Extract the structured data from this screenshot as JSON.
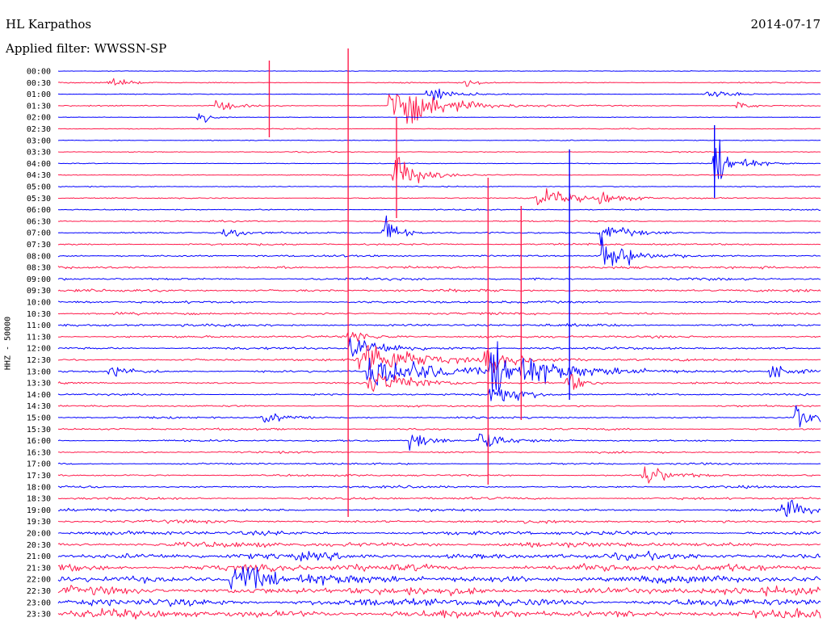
{
  "header": {
    "station": "HL Karpathos",
    "date": "2014-07-17",
    "filter": "Applied filter: WWSSN-SP",
    "channel": "HHZ - 50000"
  },
  "colors": {
    "trace_a": "#0000ff",
    "trace_b": "#ff1a4b"
  },
  "chart_data": {
    "type": "line",
    "title": "HL Karpathos",
    "date": "2014-07-17",
    "filter": "WWSSN-SP",
    "ylabel": "HHZ - 50000",
    "row_labels": [
      "00:00",
      "00:30",
      "01:00",
      "01:30",
      "02:00",
      "02:30",
      "03:00",
      "03:30",
      "04:00",
      "04:30",
      "05:00",
      "05:30",
      "06:00",
      "06:30",
      "07:00",
      "07:30",
      "08:00",
      "08:30",
      "09:00",
      "09:30",
      "10:00",
      "10:30",
      "11:00",
      "11:30",
      "12:00",
      "12:30",
      "13:00",
      "13:30",
      "14:00",
      "14:30",
      "15:00",
      "15:30",
      "16:00",
      "16:30",
      "17:00",
      "17:30",
      "18:00",
      "18:30",
      "19:00",
      "19:30",
      "20:00",
      "20:30",
      "21:00",
      "21:30",
      "22:00",
      "22:30",
      "23:00",
      "23:30"
    ],
    "series": [
      {
        "color": "#0000ff",
        "rows": "even"
      },
      {
        "color": "#ff1a4b",
        "rows": "odd"
      }
    ],
    "noise_level": [
      0.3,
      0.5,
      0.4,
      0.6,
      0.3,
      0.5,
      0.4,
      0.5,
      0.4,
      0.5,
      0.5,
      0.6,
      0.6,
      0.7,
      0.9,
      1.0,
      1.1,
      1.2,
      1.2,
      1.3,
      1.2,
      1.2,
      1.3,
      1.2,
      1.2,
      1.1,
      1.0,
      0.9,
      0.9,
      0.9,
      0.9,
      1.0,
      0.9,
      0.9,
      0.9,
      1.0,
      1.1,
      1.2,
      1.3,
      1.5,
      2.0,
      2.6,
      3.2,
      3.6,
      3.8,
      3.8,
      3.9,
      4.0
    ],
    "events": [
      {
        "row": 1,
        "minute": 2.0,
        "amp": 6,
        "dur": 0.6
      },
      {
        "row": 1,
        "minute": 16.0,
        "amp": 4,
        "dur": 0.5
      },
      {
        "row": 2,
        "minute": 14.5,
        "amp": 10,
        "dur": 0.8
      },
      {
        "row": 2,
        "minute": 25.5,
        "amp": 5,
        "dur": 0.8
      },
      {
        "row": 3,
        "minute": 6.2,
        "amp": 8,
        "dur": 0.5
      },
      {
        "row": 3,
        "minute": 13.0,
        "amp": 30,
        "dur": 1.5
      },
      {
        "row": 3,
        "minute": 26.6,
        "amp": 6,
        "dur": 0.4
      },
      {
        "row": 4,
        "minute": 5.5,
        "amp": 12,
        "dur": 0.3
      },
      {
        "row": 9,
        "minute": 13.2,
        "amp": 25,
        "dur": 0.8
      },
      {
        "row": 8,
        "minute": 25.8,
        "amp": 30,
        "dur": 0.7
      },
      {
        "row": 11,
        "minute": 18.8,
        "amp": 10,
        "dur": 1.5
      },
      {
        "row": 11,
        "minute": 21.3,
        "amp": 6,
        "dur": 0.8
      },
      {
        "row": 14,
        "minute": 6.5,
        "amp": 10,
        "dur": 0.5
      },
      {
        "row": 14,
        "minute": 12.8,
        "amp": 20,
        "dur": 0.5
      },
      {
        "row": 14,
        "minute": 21.3,
        "amp": 12,
        "dur": 0.8
      },
      {
        "row": 16,
        "minute": 21.4,
        "amp": 24,
        "dur": 0.8
      },
      {
        "row": 23,
        "minute": 11.4,
        "amp": 8,
        "dur": 0.8
      },
      {
        "row": 24,
        "minute": 11.5,
        "amp": 14,
        "dur": 1.2
      },
      {
        "row": 25,
        "minute": 11.8,
        "amp": 24,
        "dur": 1.8
      },
      {
        "row": 25,
        "minute": 16.8,
        "amp": 12,
        "dur": 1.0
      },
      {
        "row": 26,
        "minute": 2.0,
        "amp": 6,
        "dur": 1.0
      },
      {
        "row": 26,
        "minute": 12.2,
        "amp": 22,
        "dur": 2.0
      },
      {
        "row": 26,
        "minute": 17.0,
        "amp": 30,
        "dur": 2.0
      },
      {
        "row": 26,
        "minute": 28.0,
        "amp": 8,
        "dur": 0.6
      },
      {
        "row": 27,
        "minute": 12.2,
        "amp": 14,
        "dur": 1.5
      },
      {
        "row": 27,
        "minute": 20.0,
        "amp": 12,
        "dur": 0.5
      },
      {
        "row": 28,
        "minute": 17.0,
        "amp": 14,
        "dur": 1.0
      },
      {
        "row": 30,
        "minute": 8.0,
        "amp": 8,
        "dur": 0.8
      },
      {
        "row": 30,
        "minute": 29.0,
        "amp": 14,
        "dur": 0.6
      },
      {
        "row": 32,
        "minute": 13.8,
        "amp": 10,
        "dur": 0.8
      },
      {
        "row": 32,
        "minute": 16.5,
        "amp": 12,
        "dur": 0.8
      },
      {
        "row": 35,
        "minute": 23.0,
        "amp": 12,
        "dur": 0.8
      },
      {
        "row": 38,
        "minute": 28.5,
        "amp": 12,
        "dur": 0.8
      },
      {
        "row": 44,
        "minute": 6.8,
        "amp": 20,
        "dur": 1.2
      }
    ],
    "spikes": [
      {
        "x_minute": 11.4,
        "y_top": 60,
        "y_bottom": 640,
        "color": "#ff1a4b"
      },
      {
        "x_minute": 8.3,
        "y_top": 75,
        "y_bottom": 170,
        "color": "#ff1a4b"
      },
      {
        "x_minute": 13.3,
        "y_top": 145,
        "y_bottom": 270,
        "color": "#ff1a4b"
      },
      {
        "x_minute": 20.1,
        "y_top": 185,
        "y_bottom": 495,
        "color": "#0000ff"
      },
      {
        "x_minute": 16.9,
        "y_top": 220,
        "y_bottom": 600,
        "color": "#ff1a4b"
      },
      {
        "x_minute": 25.8,
        "y_top": 155,
        "y_bottom": 245,
        "color": "#0000ff"
      },
      {
        "x_minute": 18.2,
        "y_top": 255,
        "y_bottom": 520,
        "color": "#ff1a4b"
      }
    ]
  }
}
